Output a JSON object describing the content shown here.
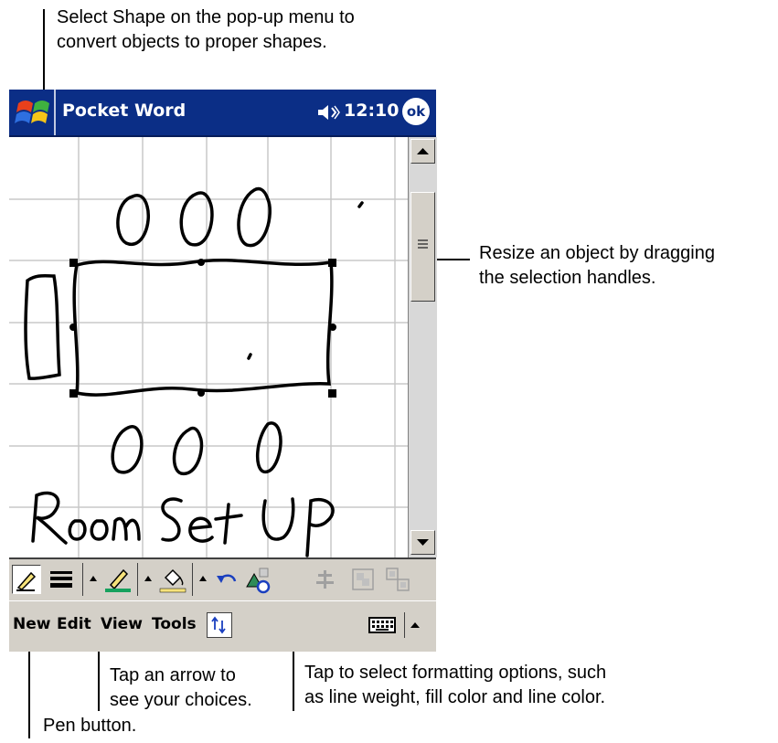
{
  "callouts": {
    "top": "Select Shape on the pop-up menu to\nconvert objects to proper shapes.",
    "resize": "Resize an object by dragging\nthe selection handles.",
    "arrow": "Tap an arrow to\nsee your choices.",
    "format": "Tap to select formatting options, such\nas line weight, fill color and line color.",
    "pen": "Pen button."
  },
  "titlebar": {
    "title": "Pocket Word",
    "time": "12:10",
    "ok_label": "ok",
    "start_icon": "windows-flag-icon",
    "speaker_icon": "speaker-icon"
  },
  "canvas": {
    "handwriting": "Room Set UP"
  },
  "toolbar": {
    "buttons": [
      "pen-icon",
      "line-weight-icon",
      "line-color-icon",
      "fill-color-icon",
      "undo-icon",
      "shape-format-icon",
      "align-icon",
      "group-icon",
      "ungroup-icon"
    ]
  },
  "menubar": {
    "new": "New",
    "edit": "Edit",
    "view": "View",
    "tools": "Tools",
    "input_icon": "keyboard-icon"
  },
  "colors": {
    "titlebar": "#0b2e86",
    "toolbar": "#d4d0c8",
    "grid": "#c8c8c8"
  }
}
